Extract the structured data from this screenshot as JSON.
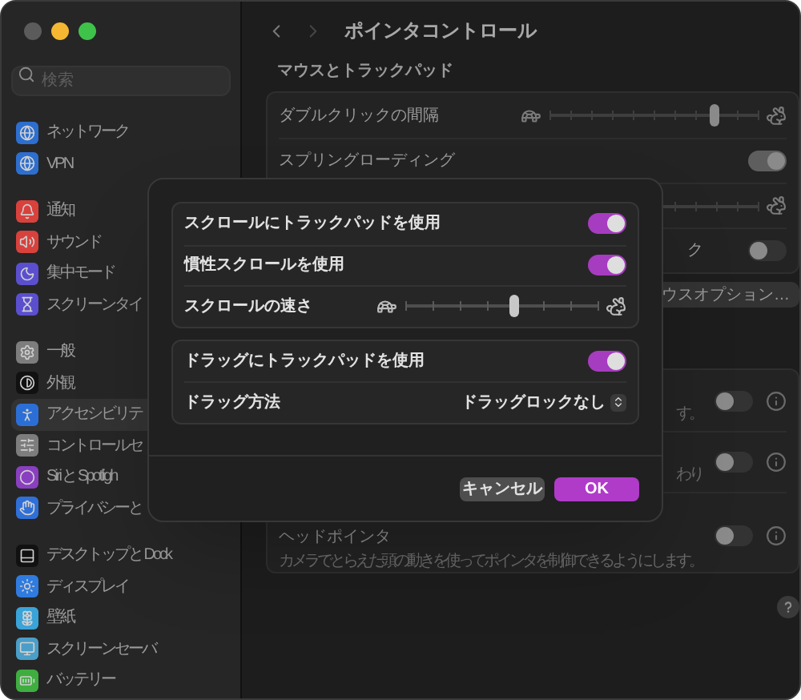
{
  "sidebar": {
    "search": {
      "placeholder": "検索"
    },
    "groups": [
      {
        "items": [
          {
            "label": "ネットワーク",
            "color": "#2d6fcf",
            "selected": false
          },
          {
            "label": "VPN",
            "color": "#2d6fcf",
            "selected": false
          }
        ]
      },
      {
        "items": [
          {
            "label": "通知",
            "color": "#d8413c",
            "selected": false
          },
          {
            "label": "サウンド",
            "color": "#d8413c",
            "selected": false
          },
          {
            "label": "集中モード",
            "color": "#5b4fcf",
            "selected": false
          },
          {
            "label": "スクリーンタイ",
            "color": "#5b4fcf",
            "selected": false
          }
        ]
      },
      {
        "items": [
          {
            "label": "一般",
            "color": "#7d7d7d",
            "selected": false
          },
          {
            "label": "外観",
            "color": "#111111",
            "selected": false
          },
          {
            "label": "アクセシビリテ",
            "color": "#2b6fd6",
            "selected": true
          },
          {
            "label": "コントロールセ",
            "color": "#7d7d7d",
            "selected": false
          },
          {
            "label": "Siri と Spotligh",
            "color": "#8a3fc0",
            "selected": false
          },
          {
            "label": "プライバシーと",
            "color": "#2f6fd8",
            "selected": false
          }
        ]
      },
      {
        "items": [
          {
            "label": "デスクトップと Dock",
            "color": "#111111",
            "selected": false
          },
          {
            "label": "ディスプレイ",
            "color": "#2f7be0",
            "selected": false
          },
          {
            "label": "壁紙",
            "color": "#3aa3d8",
            "selected": false
          },
          {
            "label": "スクリーンセーバ",
            "color": "#4a9ec8",
            "selected": false
          },
          {
            "label": "バッテリー",
            "color": "#3fae3f",
            "selected": false
          }
        ]
      }
    ]
  },
  "main": {
    "title": "ポインタコントロール",
    "section_title": "マウスとトラックパッド",
    "rows": [
      {
        "kind": "slider",
        "label": "ダブルクリックの間隔",
        "level": 0.79
      },
      {
        "kind": "toggle",
        "label": "スプリングローディング",
        "on": true
      },
      {
        "kind": "slider"
      },
      {
        "kind": "toggle",
        "label_tail": "ク",
        "on": false
      }
    ],
    "options_button": "ウスオプション…",
    "rows2": [
      {
        "description_tail": "す。",
        "on": false
      },
      {
        "description_tail": "わり",
        "on": false
      },
      {
        "label": "ヘッドポインタ",
        "description": "カメラでとらえた頭の動きを使ってポインタを制御できるようにします。",
        "on": false
      }
    ]
  },
  "dialog": {
    "groups": [
      {
        "rows": [
          {
            "kind": "toggle",
            "label": "スクロールにトラックパッドを使用",
            "on": true
          },
          {
            "kind": "toggle",
            "label": "慣性スクロールを使用",
            "on": true
          },
          {
            "kind": "slider",
            "label": "スクロールの速さ",
            "level": 0.57
          }
        ]
      },
      {
        "rows": [
          {
            "kind": "toggle",
            "label": "ドラッグにトラックパッドを使用",
            "on": true
          },
          {
            "kind": "popup",
            "label": "ドラッグ方法",
            "value": "ドラッグロックなし"
          }
        ]
      }
    ],
    "buttons": [
      {
        "label": "キャンセル",
        "kind": "secondary"
      },
      {
        "label": "OK",
        "kind": "primary"
      }
    ]
  }
}
